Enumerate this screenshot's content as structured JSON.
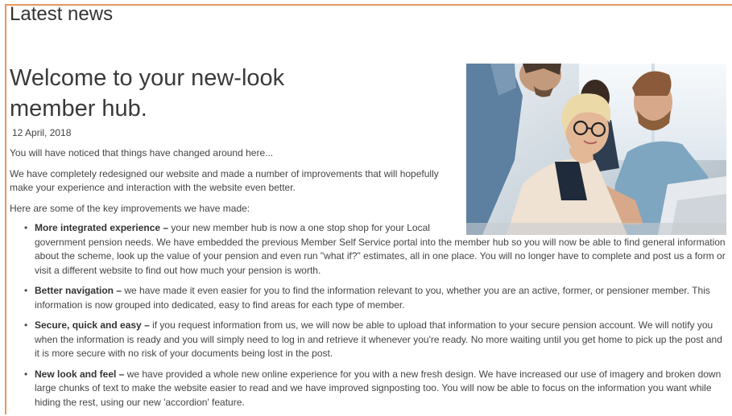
{
  "section": {
    "title": "Latest news"
  },
  "article": {
    "headline": "Welcome to your new-look member hub.",
    "date": "12 April, 2018",
    "paragraphs": [
      "You will have noticed that things have changed around here...",
      "We have completely redesigned our website and made a number of improvements that will hopefully make your experience and interaction with the website even better.",
      "Here are some of the key improvements we have made:"
    ],
    "image": {
      "alt": "Three colleagues smiling while looking at a laptop screen"
    },
    "improvements": [
      {
        "title": "More integrated experience",
        "separator": " – ",
        "text_head": "your new member hub is now a one stop shop for your Local",
        "text_tail": "government pension needs. We have embedded the previous Member Self Service portal into the member hub so you will now be able to find general information about the scheme, look up the value of your pension and even run \"what if?\" estimates, all in one place. You will no longer have to complete and post us a form or visit a different website to find out how much your pension is worth."
      },
      {
        "title": "Better navigation",
        "separator": " – ",
        "text": "we have made it even easier for you to find the information relevant to you, whether you are an active, former, or pensioner member. This information is now grouped into dedicated, easy to find areas for each type of member."
      },
      {
        "title": "Secure, quick and easy",
        "separator": " – ",
        "text": "if you request information from us, we will now be able to upload that information to your secure pension account. We will notify you when the information is ready and you will simply need to log in and retrieve it whenever you're ready. No more waiting until you get home to pick up the post and it is more secure with no risk of your documents being lost in the post."
      },
      {
        "title": "New look and feel",
        "separator": " – ",
        "text": "we have provided a whole new online experience for you with a new fresh design. We have increased our use of imagery and broken down large chunks of text to make the website easier to read and we have improved signposting too. You will now be able to focus on the information you want while hiding the rest, using our new 'accordion' feature."
      }
    ]
  },
  "colors": {
    "frame_border": "#e8955a",
    "text": "#444444",
    "heading": "#3a3a3a"
  }
}
